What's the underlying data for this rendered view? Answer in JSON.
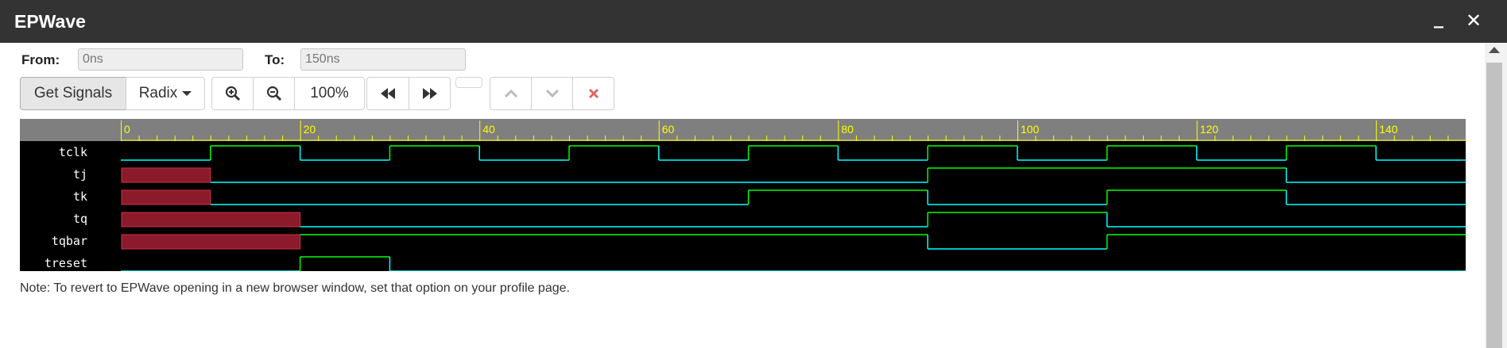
{
  "window": {
    "title": "EPWave",
    "minimize_label": "_",
    "close_label": "✕"
  },
  "range": {
    "from_label": "From:",
    "from_value": "0ns",
    "to_label": "To:",
    "to_value": "150ns"
  },
  "toolbar": {
    "get_signals_label": "Get Signals",
    "radix_label": "Radix",
    "zoom_in_icon": "zoom-in-icon",
    "zoom_out_icon": "zoom-out-icon",
    "zoom_level": "100%",
    "prev_icon": "rewind-icon",
    "next_icon": "fast-forward-icon",
    "up_icon": "chevron-up-icon",
    "down_icon": "chevron-down-icon",
    "delete_icon": "delete-icon"
  },
  "waveform": {
    "time_start": 0,
    "time_end": 150,
    "time_labels": [
      "0",
      "20",
      "40",
      "60",
      "80",
      "100",
      "120",
      "140"
    ],
    "colors": {
      "ruler_bg": "#7f7f7f",
      "ruler_fg": "#ffff00",
      "low": "#00ffff",
      "high": "#00ff00",
      "unknown": "#8b1a2b"
    },
    "signals": [
      {
        "name": "tclk",
        "segments": [
          [
            0,
            10,
            "0"
          ],
          [
            10,
            20,
            "1"
          ],
          [
            20,
            30,
            "0"
          ],
          [
            30,
            40,
            "1"
          ],
          [
            40,
            50,
            "0"
          ],
          [
            50,
            60,
            "1"
          ],
          [
            60,
            70,
            "0"
          ],
          [
            70,
            80,
            "1"
          ],
          [
            80,
            90,
            "0"
          ],
          [
            90,
            100,
            "1"
          ],
          [
            100,
            110,
            "0"
          ],
          [
            110,
            120,
            "1"
          ],
          [
            120,
            130,
            "0"
          ],
          [
            130,
            140,
            "1"
          ],
          [
            140,
            150,
            "0"
          ]
        ]
      },
      {
        "name": "tj",
        "segments": [
          [
            0,
            10,
            "x"
          ],
          [
            10,
            90,
            "0"
          ],
          [
            90,
            130,
            "1"
          ],
          [
            130,
            150,
            "0"
          ]
        ]
      },
      {
        "name": "tk",
        "segments": [
          [
            0,
            10,
            "x"
          ],
          [
            10,
            70,
            "0"
          ],
          [
            70,
            90,
            "1"
          ],
          [
            90,
            110,
            "0"
          ],
          [
            110,
            130,
            "1"
          ],
          [
            130,
            150,
            "0"
          ]
        ]
      },
      {
        "name": "tq",
        "segments": [
          [
            0,
            20,
            "x"
          ],
          [
            20,
            90,
            "0"
          ],
          [
            90,
            110,
            "1"
          ],
          [
            110,
            150,
            "0"
          ]
        ]
      },
      {
        "name": "tqbar",
        "segments": [
          [
            0,
            20,
            "x"
          ],
          [
            20,
            90,
            "1"
          ],
          [
            90,
            110,
            "0"
          ],
          [
            110,
            150,
            "1"
          ]
        ]
      },
      {
        "name": "treset",
        "segments": [
          [
            0,
            20,
            "0"
          ],
          [
            20,
            30,
            "1"
          ],
          [
            30,
            150,
            "0"
          ]
        ]
      }
    ]
  },
  "note": "Note: To revert to EPWave opening in a new browser window, set that option on your profile page."
}
